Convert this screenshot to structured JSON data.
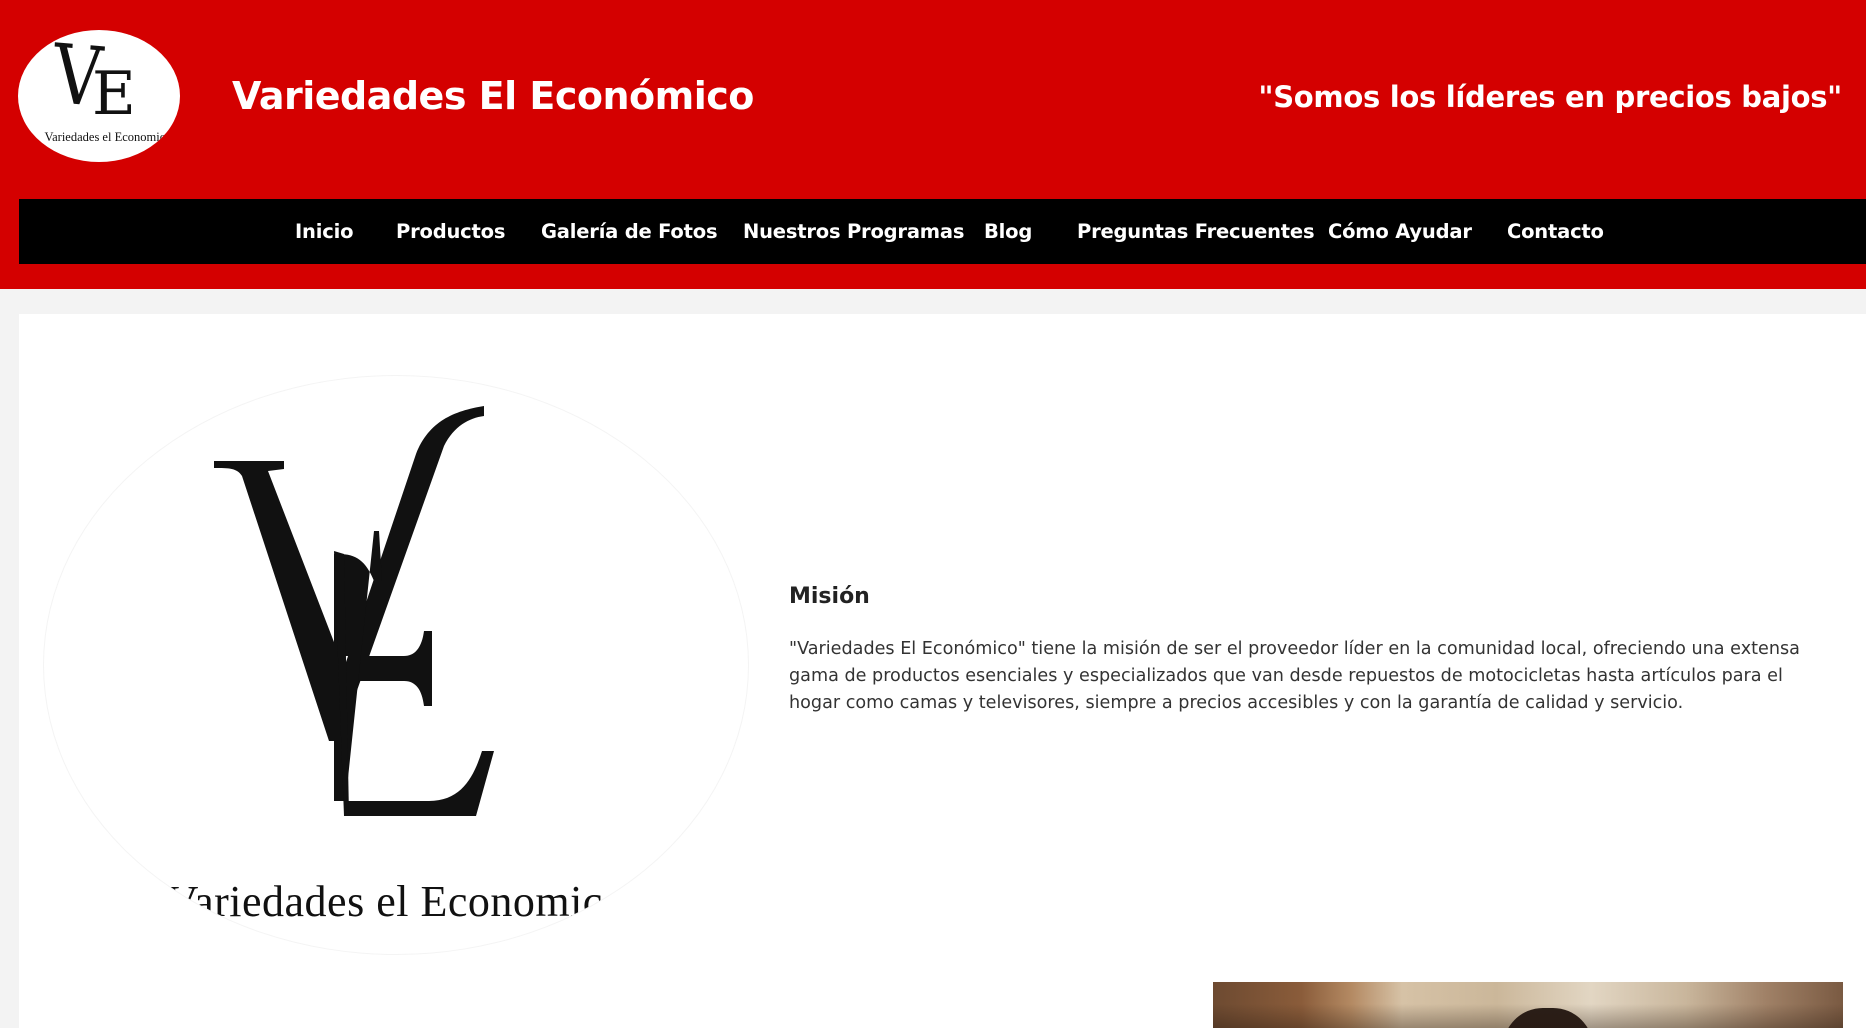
{
  "header": {
    "logo_monogram_v": "V",
    "logo_monogram_e": "E",
    "logo_caption": "Variedades el Economico",
    "site_title": "Variedades El Económico",
    "tagline": "\"Somos los líderes en precios bajos\""
  },
  "nav": {
    "items": [
      {
        "label": "Inicio"
      },
      {
        "label": "Productos"
      },
      {
        "label": "Galería de Fotos"
      },
      {
        "label": "Nuestros Programas"
      },
      {
        "label": "Blog"
      },
      {
        "label": "Preguntas Frecuentes"
      },
      {
        "label": "Cómo Ayudar"
      },
      {
        "label": "Contacto"
      }
    ]
  },
  "content": {
    "large_logo": {
      "monogram_v": "V",
      "monogram_e": "E",
      "caption": "Variedades el Economico"
    },
    "mision": {
      "title": "Misión",
      "text": "\"Variedades El Económico\" tiene la misión de ser el proveedor líder en la comunidad local, ofreciendo una extensa gama de productos esenciales y especializados que van desde repuestos de motocicletas hasta artículos para el hogar como camas y televisores, siempre a precios accesibles y con la garantía de calidad y servicio."
    }
  },
  "colors": {
    "header_bg": "#d40000",
    "nav_bg": "#000000",
    "page_bg": "#f3f3f3",
    "card_bg": "#ffffff",
    "text_light": "#ffffff",
    "text_dark": "#333333"
  }
}
